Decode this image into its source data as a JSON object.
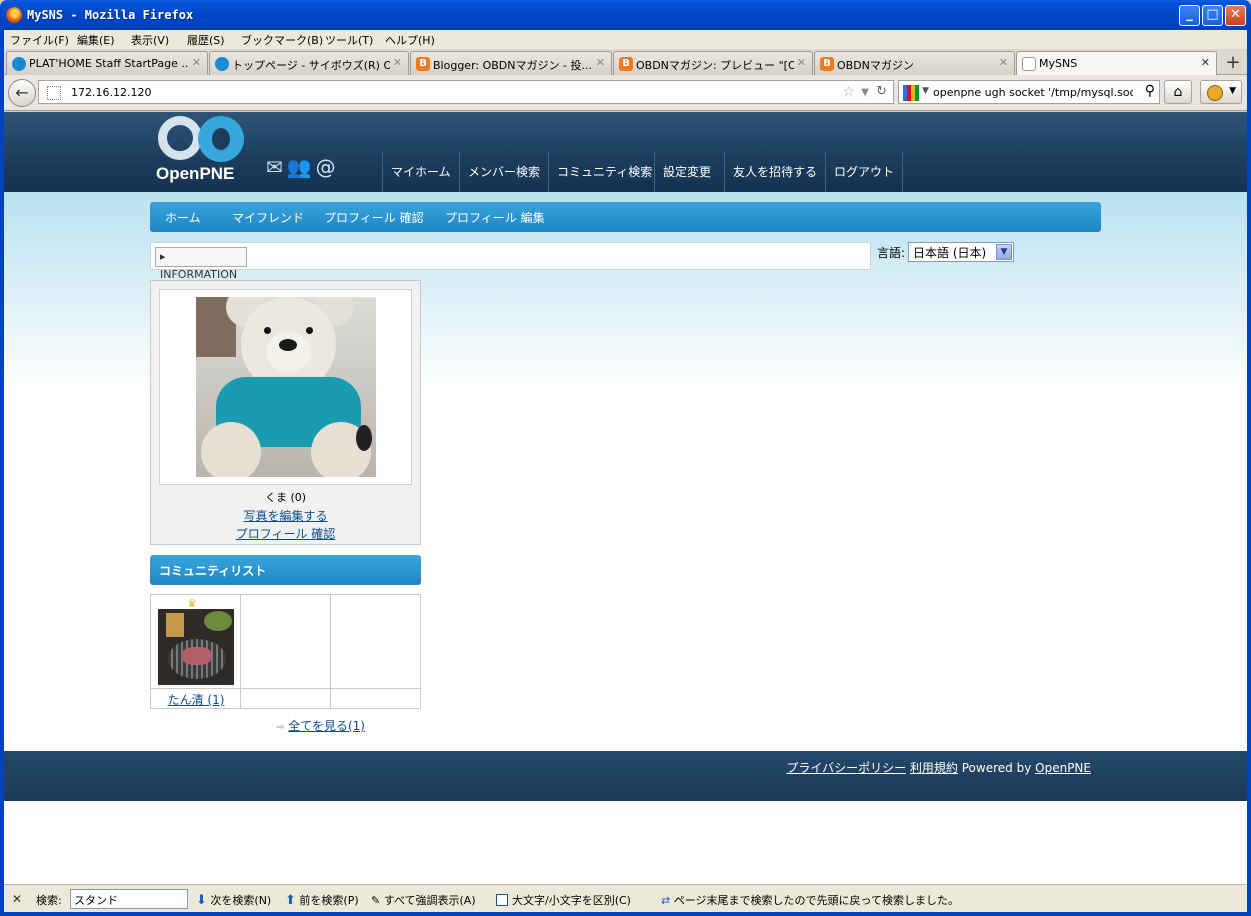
{
  "window": {
    "title": "MySNS - Mozilla Firefox"
  },
  "menu": [
    "ファイル(F)",
    "編集(E)",
    "表示(V)",
    "履歴(S)",
    "ブックマーク(B)",
    "ツール(T)",
    "ヘルプ(H)"
  ],
  "tabs": [
    {
      "label": "PLAT'HOME Staff StartPage ...",
      "icon": "globe-icon"
    },
    {
      "label": "トップページ - サイボウズ(R) Off...",
      "icon": "globe-icon"
    },
    {
      "label": "Blogger: OBDNマガジン - 投...",
      "icon": "blogger-icon"
    },
    {
      "label": "OBDNマガジン: プレビュー \"[OB...",
      "icon": "blogger-icon"
    },
    {
      "label": "OBDNマガジン",
      "icon": "blogger-icon"
    },
    {
      "label": "MySNS",
      "icon": "blank-page-icon"
    }
  ],
  "nav": {
    "url": "172.16.12.120",
    "search_text": "openpne ugh socket '/tmp/mysql.sock'"
  },
  "site": {
    "logo_text": "OpenPNE",
    "global_nav": [
      "マイホーム",
      "メンバー検索",
      "コミュニティ検索",
      "設定変更",
      "友人を招待する",
      "ログアウト"
    ],
    "local_nav": [
      "ホーム",
      "マイフレンド",
      "プロフィール 確認",
      "プロフィール 編集"
    ],
    "info_label": "INFORMATION",
    "lang_label": "言語:",
    "lang_value": "日本語 (日本)",
    "profile": {
      "name": "くま (0)",
      "edit_photo": "写真を編集する",
      "view_profile": "プロフィール 確認"
    },
    "community": {
      "header": "コミュニティリスト",
      "items": [
        {
          "name": "たん清 (1)"
        }
      ],
      "see_all": "全てを見る(1)"
    },
    "footer": {
      "privacy": "プライバシーポリシー",
      "terms": "利用規約",
      "powered": "Powered by",
      "openpne": "OpenPNE"
    }
  },
  "findbar": {
    "label": "検索:",
    "value": "スタンド",
    "next": "次を検索(N)",
    "prev": "前を検索(P)",
    "highlight": "すべて強調表示(A)",
    "match_case": "大文字/小文字を区別(C)",
    "status": "ページ末尾まで検索したので先頭に戻って検索しました。"
  }
}
